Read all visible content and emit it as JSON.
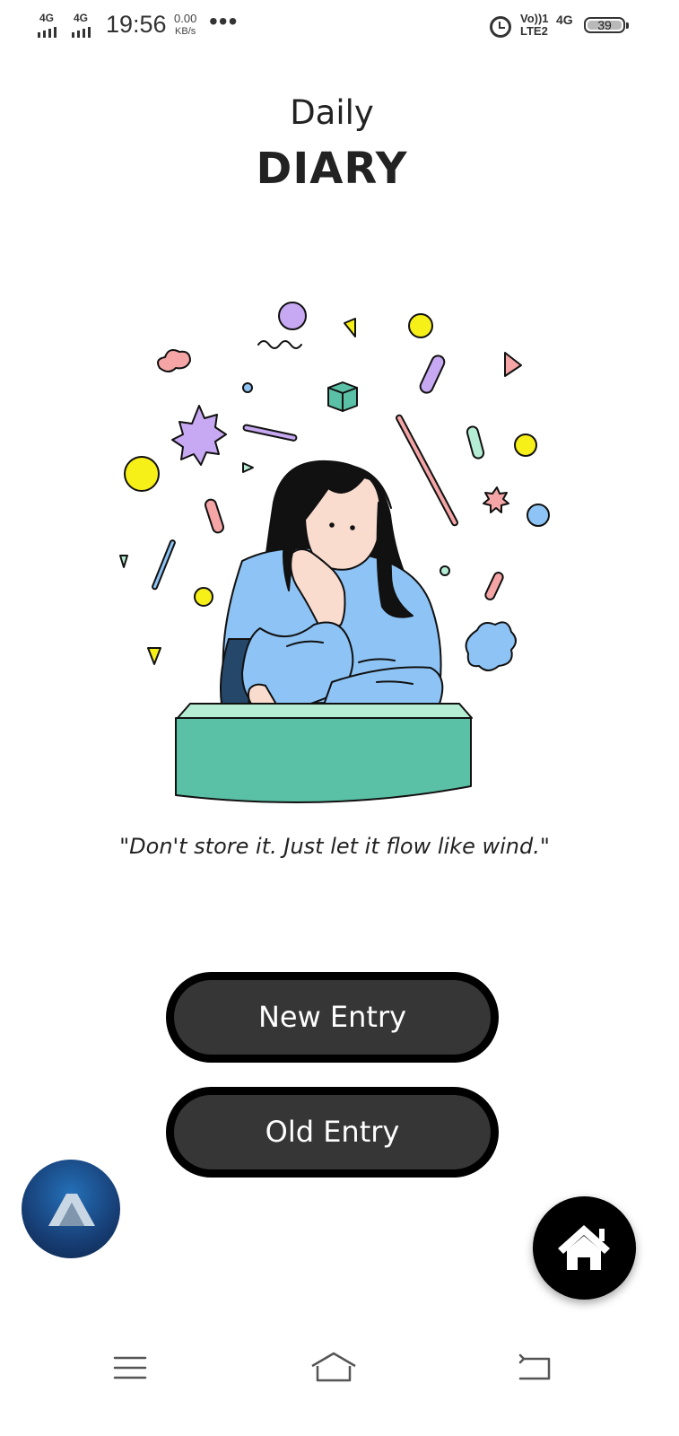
{
  "status_bar": {
    "sim1_network": "4G",
    "sim2_network": "4G",
    "time": "19:56",
    "speed_value": "0.00",
    "speed_unit": "KB/s",
    "more_indicator": "•••",
    "volte_line1": "Vo))1",
    "volte_line2": "LTE2",
    "data_network": "4G",
    "battery_level": "39",
    "icons": [
      "signal-icon",
      "signal-icon",
      "alarm-icon",
      "battery-icon"
    ]
  },
  "header": {
    "title_small": "Daily",
    "title_big": "DIARY"
  },
  "quote": "\"Don't store it. Just let it flow like wind.\"",
  "buttons": {
    "new_entry": "New Entry",
    "old_entry": "Old Entry"
  },
  "floating": {
    "logo_icon": "app-logo-icon",
    "home_icon": "home-icon"
  },
  "nav_bar": {
    "icons": [
      "menu-icon",
      "home-outline-icon",
      "back-icon"
    ]
  },
  "colors": {
    "button_fill": "#363636",
    "button_border": "#000000",
    "sweater": "#8ec4f5",
    "desk": "#5bc1a6",
    "confetti_yellow": "#f7ef18",
    "confetti_purple": "#c7a8f2",
    "confetti_pink": "#f5a5a5"
  }
}
